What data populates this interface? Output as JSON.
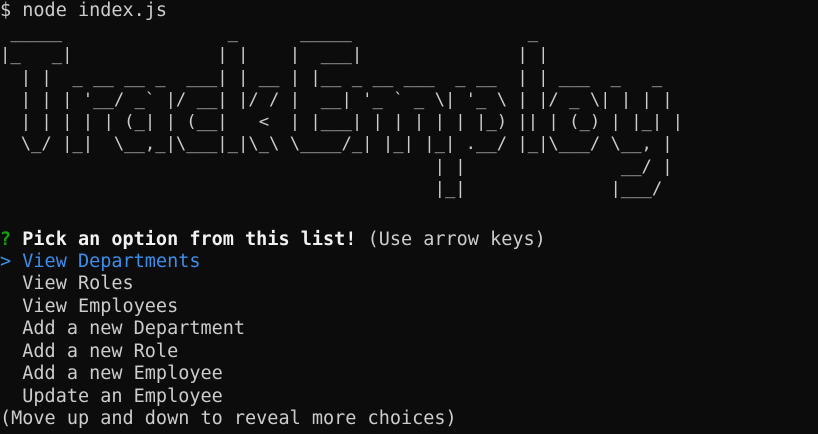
{
  "terminal": {
    "prompt_symbol": "$",
    "command": "node index.js"
  },
  "banner": {
    "text": "TrackEmploy",
    "ascii_art": " _____                _      _____                 _\n|_   _|              | |    |  ___|               | |\n  | |  _ __ __ _  ___| | __ | |__ _ __ ___  _ __  | | ___  _   _\n  | | | '__/ _` |/ __| |/ / |  __| '_ ` _ \\| '_ \\ | |/ _ \\| | | |\n  | | | | | (_| | (__|   <  | |___| | | | | | |_) || | (_) | |_| |\n  \\_/ |_|  \\__,_|\\___|_|\\_\\ \\____/_| |_| |_| .__/ |_|\\___/ \\__, |\n                                          | |               __/ |\n                                          |_|              |___/"
  },
  "prompt": {
    "question_mark": "?",
    "question": "Pick an option from this list!",
    "hint": "(Use arrow keys)",
    "pointer": ">",
    "selected_index": 0,
    "options": [
      "View Departments",
      "View Roles",
      "View Employees",
      "Add a new Department",
      "Add a new Role",
      "Add a new Employee",
      "Update an Employee"
    ],
    "footer": "(Move up and down to reveal more choices)"
  },
  "colors": {
    "background": "#0c0c0c",
    "text": "#cccccc",
    "question_mark": "#13a10e",
    "selected": "#3b8eea"
  }
}
